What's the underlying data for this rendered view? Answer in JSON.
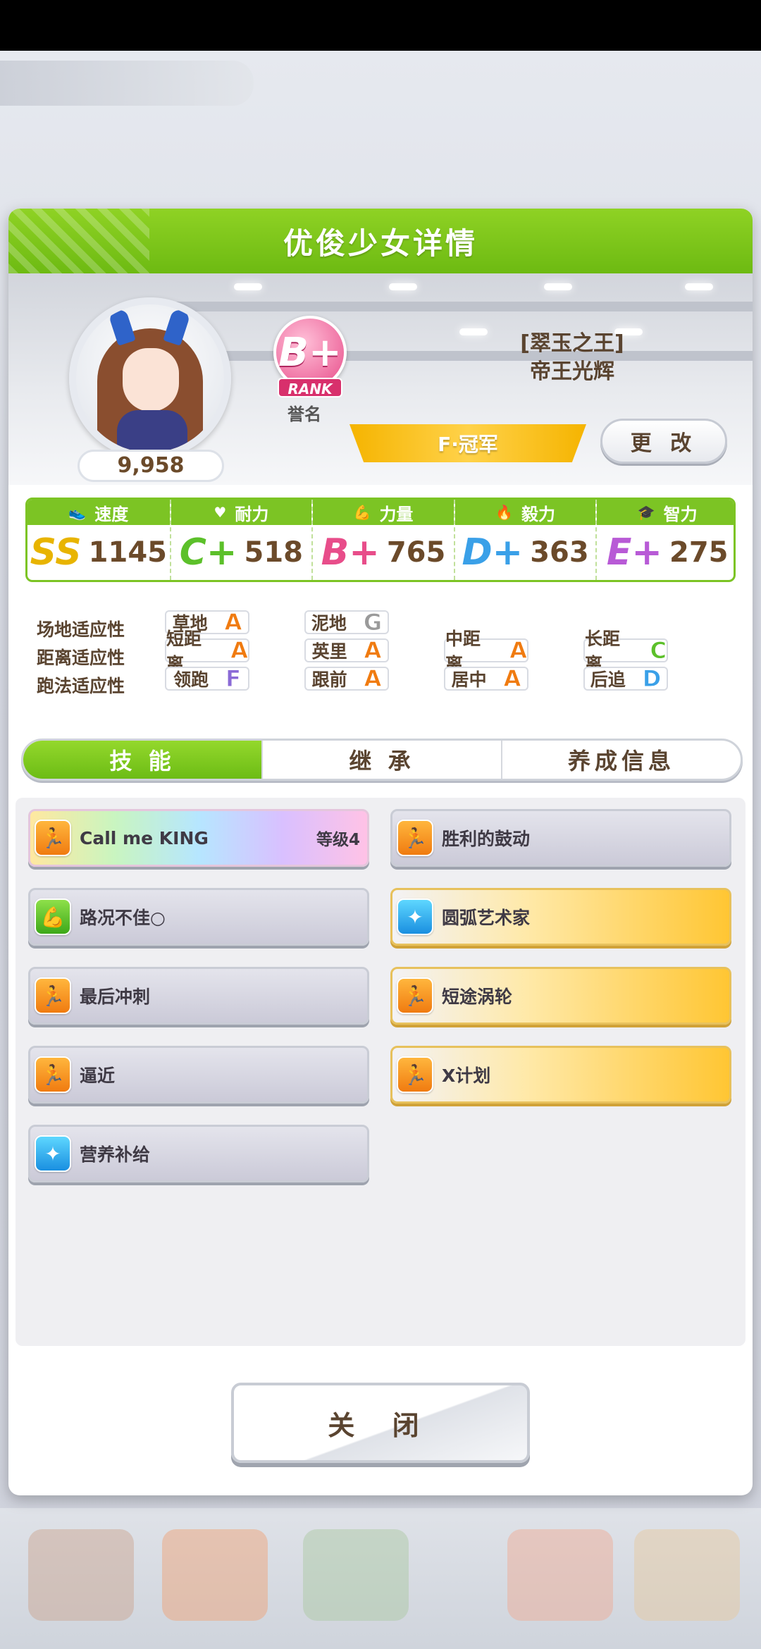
{
  "panel": {
    "title": "优俊少女详情"
  },
  "profile": {
    "score": "9,958",
    "rank_grade": "B+",
    "rank_label": "RANK",
    "rank_caption": "誉名",
    "title_line1": "[翠玉之王]",
    "title_line2": "帝王光辉",
    "fame_title": "F·冠军",
    "change_label": "更 改"
  },
  "stats": [
    {
      "name": "速度",
      "icon": "shoe-icon",
      "grade": "SS",
      "value": "1145",
      "color": "#e8b400"
    },
    {
      "name": "耐力",
      "icon": "heart-icon",
      "grade": "C+",
      "value": "518",
      "color": "#5cc02a"
    },
    {
      "name": "力量",
      "icon": "muscle-icon",
      "grade": "B+",
      "value": "765",
      "color": "#e84d8a"
    },
    {
      "name": "毅力",
      "icon": "flame-icon",
      "grade": "D+",
      "value": "363",
      "color": "#3aa0e8"
    },
    {
      "name": "智力",
      "icon": "graduation-cap-icon",
      "grade": "E+",
      "value": "275",
      "color": "#b85ad6"
    }
  ],
  "aptitude": {
    "rows": [
      {
        "label": "场地适应性",
        "cells": [
          {
            "name": "草地",
            "grade": "A"
          },
          {
            "name": "泥地",
            "grade": "G"
          }
        ]
      },
      {
        "label": "距离适应性",
        "cells": [
          {
            "name": "短距离",
            "grade": "A"
          },
          {
            "name": "英里",
            "grade": "A"
          },
          {
            "name": "中距离",
            "grade": "A"
          },
          {
            "name": "长距离",
            "grade": "C"
          }
        ]
      },
      {
        "label": "跑法适应性",
        "cells": [
          {
            "name": "领跑",
            "grade": "F"
          },
          {
            "name": "跟前",
            "grade": "A"
          },
          {
            "name": "居中",
            "grade": "A"
          },
          {
            "name": "后追",
            "grade": "D"
          }
        ]
      }
    ],
    "grade_colors": {
      "A": "#f07b10",
      "C": "#5cc02a",
      "D": "#3aa0e8",
      "F": "#8a6ad6",
      "G": "#9a9a9a"
    }
  },
  "tabs": [
    {
      "label": "技 能",
      "active": true
    },
    {
      "label": "继 承",
      "active": false
    },
    {
      "label": "养成信息",
      "active": false
    }
  ],
  "skills": [
    {
      "name": "Call me KING",
      "level": "等级4",
      "style": "rainbow",
      "icon_color": "orange",
      "icon": "running-figure-icon"
    },
    {
      "name": "胜利的鼓动",
      "style": "gray",
      "icon_color": "orange",
      "icon": "running-figure-icon"
    },
    {
      "name": "路况不佳○",
      "style": "gray",
      "icon_color": "green",
      "icon": "muscle-icon"
    },
    {
      "name": "圆弧艺术家",
      "style": "gold",
      "icon_color": "blue",
      "icon": "sparkle-icon"
    },
    {
      "name": "最后冲刺",
      "style": "gray",
      "icon_color": "orange",
      "icon": "running-figure-icon"
    },
    {
      "name": "短途涡轮",
      "style": "gold",
      "icon_color": "orange",
      "icon": "running-figure-icon"
    },
    {
      "name": "逼近",
      "style": "gray",
      "icon_color": "orange",
      "icon": "running-figure-icon"
    },
    {
      "name": "X计划",
      "style": "gold",
      "icon_color": "orange",
      "icon": "running-figure-icon"
    },
    {
      "name": "营养补给",
      "style": "gray",
      "icon_color": "blue",
      "icon": "sparkle-icon"
    }
  ],
  "close_label": "关 闭"
}
